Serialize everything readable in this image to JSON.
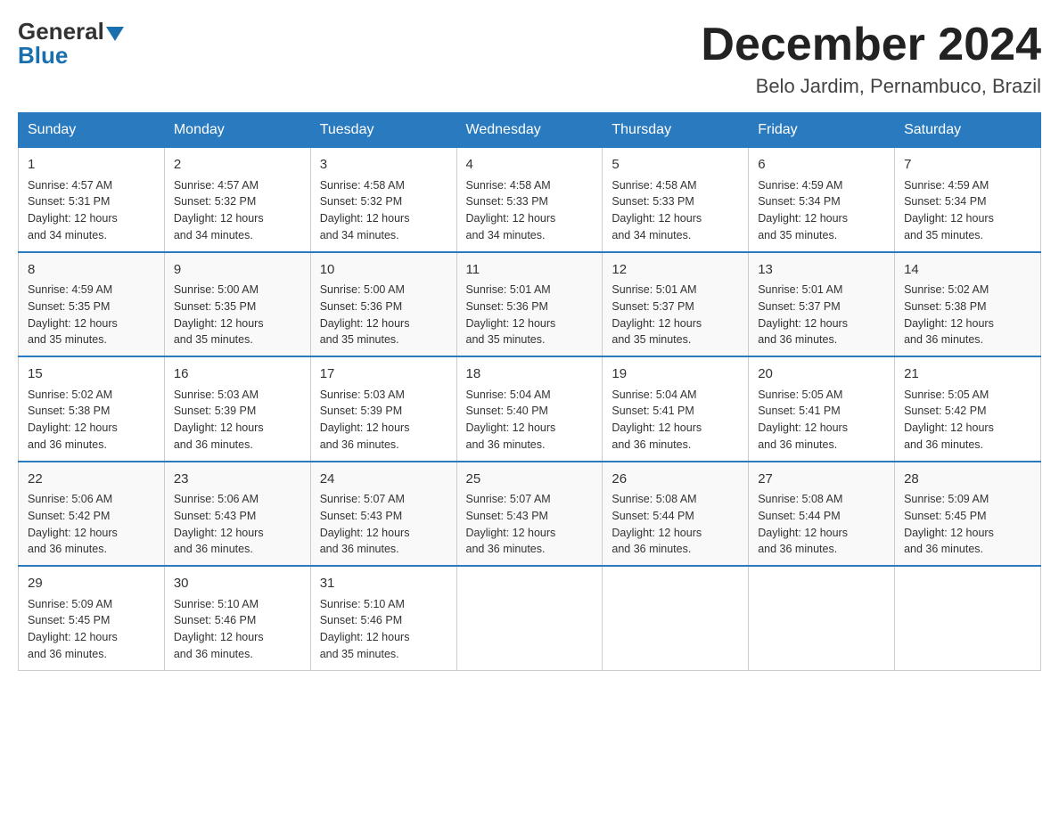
{
  "logo": {
    "general": "General",
    "triangle": "",
    "blue": "Blue"
  },
  "header": {
    "month_year": "December 2024",
    "location": "Belo Jardim, Pernambuco, Brazil"
  },
  "days_of_week": [
    "Sunday",
    "Monday",
    "Tuesday",
    "Wednesday",
    "Thursday",
    "Friday",
    "Saturday"
  ],
  "weeks": [
    [
      {
        "day": "1",
        "sunrise": "4:57 AM",
        "sunset": "5:31 PM",
        "daylight": "12 hours and 34 minutes."
      },
      {
        "day": "2",
        "sunrise": "4:57 AM",
        "sunset": "5:32 PM",
        "daylight": "12 hours and 34 minutes."
      },
      {
        "day": "3",
        "sunrise": "4:58 AM",
        "sunset": "5:32 PM",
        "daylight": "12 hours and 34 minutes."
      },
      {
        "day": "4",
        "sunrise": "4:58 AM",
        "sunset": "5:33 PM",
        "daylight": "12 hours and 34 minutes."
      },
      {
        "day": "5",
        "sunrise": "4:58 AM",
        "sunset": "5:33 PM",
        "daylight": "12 hours and 34 minutes."
      },
      {
        "day": "6",
        "sunrise": "4:59 AM",
        "sunset": "5:34 PM",
        "daylight": "12 hours and 35 minutes."
      },
      {
        "day": "7",
        "sunrise": "4:59 AM",
        "sunset": "5:34 PM",
        "daylight": "12 hours and 35 minutes."
      }
    ],
    [
      {
        "day": "8",
        "sunrise": "4:59 AM",
        "sunset": "5:35 PM",
        "daylight": "12 hours and 35 minutes."
      },
      {
        "day": "9",
        "sunrise": "5:00 AM",
        "sunset": "5:35 PM",
        "daylight": "12 hours and 35 minutes."
      },
      {
        "day": "10",
        "sunrise": "5:00 AM",
        "sunset": "5:36 PM",
        "daylight": "12 hours and 35 minutes."
      },
      {
        "day": "11",
        "sunrise": "5:01 AM",
        "sunset": "5:36 PM",
        "daylight": "12 hours and 35 minutes."
      },
      {
        "day": "12",
        "sunrise": "5:01 AM",
        "sunset": "5:37 PM",
        "daylight": "12 hours and 35 minutes."
      },
      {
        "day": "13",
        "sunrise": "5:01 AM",
        "sunset": "5:37 PM",
        "daylight": "12 hours and 36 minutes."
      },
      {
        "day": "14",
        "sunrise": "5:02 AM",
        "sunset": "5:38 PM",
        "daylight": "12 hours and 36 minutes."
      }
    ],
    [
      {
        "day": "15",
        "sunrise": "5:02 AM",
        "sunset": "5:38 PM",
        "daylight": "12 hours and 36 minutes."
      },
      {
        "day": "16",
        "sunrise": "5:03 AM",
        "sunset": "5:39 PM",
        "daylight": "12 hours and 36 minutes."
      },
      {
        "day": "17",
        "sunrise": "5:03 AM",
        "sunset": "5:39 PM",
        "daylight": "12 hours and 36 minutes."
      },
      {
        "day": "18",
        "sunrise": "5:04 AM",
        "sunset": "5:40 PM",
        "daylight": "12 hours and 36 minutes."
      },
      {
        "day": "19",
        "sunrise": "5:04 AM",
        "sunset": "5:41 PM",
        "daylight": "12 hours and 36 minutes."
      },
      {
        "day": "20",
        "sunrise": "5:05 AM",
        "sunset": "5:41 PM",
        "daylight": "12 hours and 36 minutes."
      },
      {
        "day": "21",
        "sunrise": "5:05 AM",
        "sunset": "5:42 PM",
        "daylight": "12 hours and 36 minutes."
      }
    ],
    [
      {
        "day": "22",
        "sunrise": "5:06 AM",
        "sunset": "5:42 PM",
        "daylight": "12 hours and 36 minutes."
      },
      {
        "day": "23",
        "sunrise": "5:06 AM",
        "sunset": "5:43 PM",
        "daylight": "12 hours and 36 minutes."
      },
      {
        "day": "24",
        "sunrise": "5:07 AM",
        "sunset": "5:43 PM",
        "daylight": "12 hours and 36 minutes."
      },
      {
        "day": "25",
        "sunrise": "5:07 AM",
        "sunset": "5:43 PM",
        "daylight": "12 hours and 36 minutes."
      },
      {
        "day": "26",
        "sunrise": "5:08 AM",
        "sunset": "5:44 PM",
        "daylight": "12 hours and 36 minutes."
      },
      {
        "day": "27",
        "sunrise": "5:08 AM",
        "sunset": "5:44 PM",
        "daylight": "12 hours and 36 minutes."
      },
      {
        "day": "28",
        "sunrise": "5:09 AM",
        "sunset": "5:45 PM",
        "daylight": "12 hours and 36 minutes."
      }
    ],
    [
      {
        "day": "29",
        "sunrise": "5:09 AM",
        "sunset": "5:45 PM",
        "daylight": "12 hours and 36 minutes."
      },
      {
        "day": "30",
        "sunrise": "5:10 AM",
        "sunset": "5:46 PM",
        "daylight": "12 hours and 36 minutes."
      },
      {
        "day": "31",
        "sunrise": "5:10 AM",
        "sunset": "5:46 PM",
        "daylight": "12 hours and 35 minutes."
      },
      null,
      null,
      null,
      null
    ]
  ],
  "labels": {
    "sunrise": "Sunrise:",
    "sunset": "Sunset:",
    "daylight": "Daylight:"
  }
}
